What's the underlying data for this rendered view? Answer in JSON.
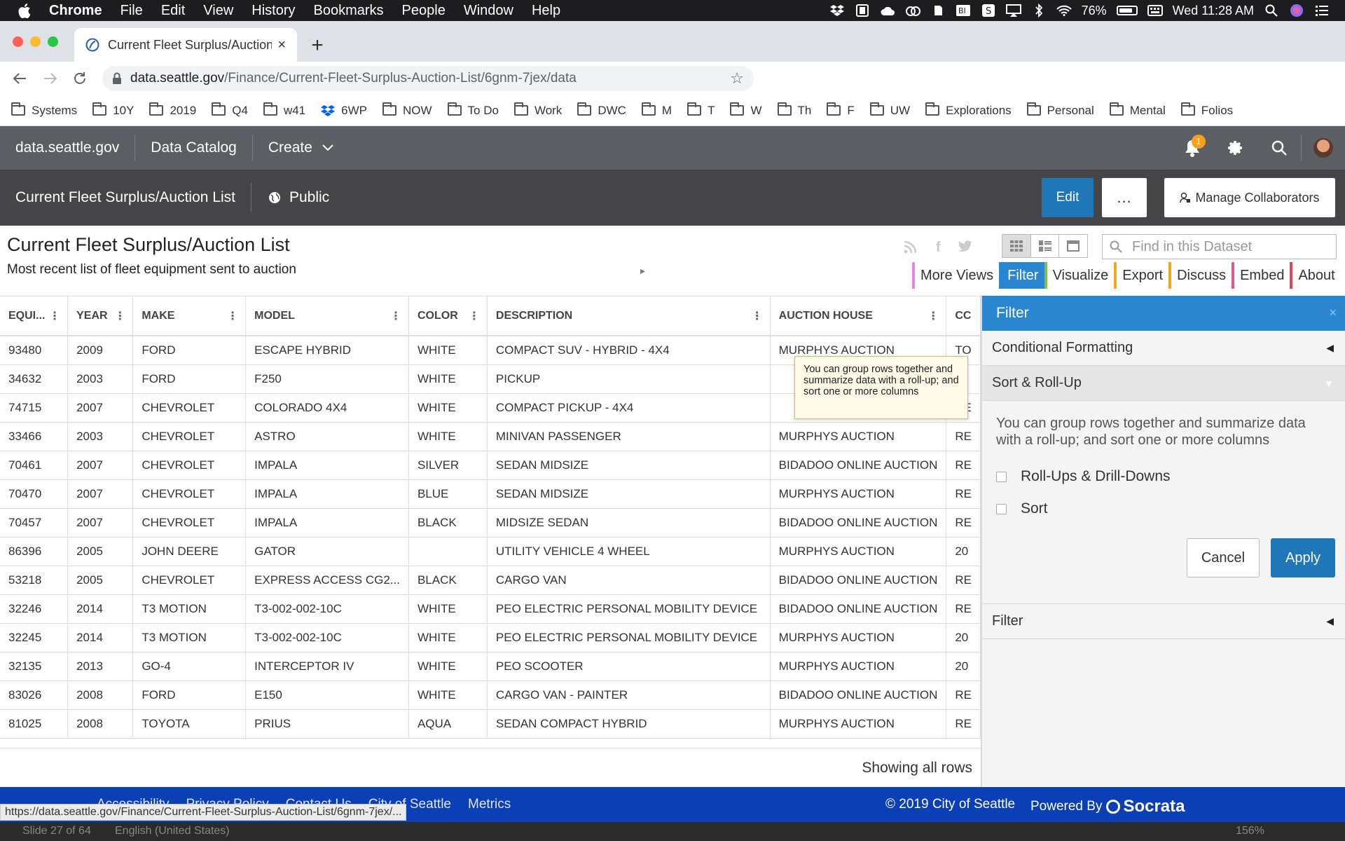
{
  "menubar": {
    "app": "Chrome",
    "items": [
      "File",
      "Edit",
      "View",
      "History",
      "Bookmarks",
      "People",
      "Window",
      "Help"
    ],
    "battery": "76%",
    "clock": "Wed 11:28 AM"
  },
  "browser": {
    "tab_title": "Current Fleet Surplus/Auction L",
    "url_host": "data.seattle.gov",
    "url_path": "/Finance/Current-Fleet-Surplus-Auction-List/6gnm-7jex/data",
    "status_url": "https://data.seattle.gov/Finance/Current-Fleet-Surplus-Auction-List/6gnm-7jex/..."
  },
  "bookmarks": [
    "Systems",
    "10Y",
    "2019",
    "Q4",
    "w41",
    "6WP",
    "NOW",
    "To Do",
    "Work",
    "DWC",
    "M",
    "T",
    "W",
    "Th",
    "F",
    "UW",
    "Explorations",
    "Personal",
    "Mental",
    "Folios"
  ],
  "sitenav": {
    "brand": "data.seattle.gov",
    "catalog": "Data Catalog",
    "create": "Create",
    "notification_count": "1"
  },
  "datasetbar": {
    "title": "Current Fleet Surplus/Auction List",
    "visibility": "Public",
    "edit": "Edit",
    "more": "...",
    "collaborators": "Manage Collaborators"
  },
  "dataset": {
    "title": "Current Fleet Surplus/Auction List",
    "subtitle": "Most recent list of fleet equipment sent to auction",
    "search_placeholder": "Find in this Dataset",
    "tabs": [
      {
        "label": "More Views",
        "color": "#e08ad8"
      },
      {
        "label": "Filter",
        "color": "#2a87cf"
      },
      {
        "label": "Visualize",
        "color": "#7fc241"
      },
      {
        "label": "Export",
        "color": "#f5a623"
      },
      {
        "label": "Discuss",
        "color": "#f5a623"
      },
      {
        "label": "Embed",
        "color": "#e05a87"
      },
      {
        "label": "About",
        "color": "#e0444f"
      }
    ]
  },
  "grid": {
    "columns": [
      "EQUI...",
      "YEAR",
      "MAKE",
      "MODEL",
      "COLOR",
      "DESCRIPTION",
      "AUCTION HOUSE",
      "CC"
    ],
    "rows": [
      [
        "93480",
        "2009",
        "FORD",
        "ESCAPE HYBRID",
        "WHITE",
        "COMPACT SUV - HYBRID - 4X4",
        "MURPHYS AUCTION",
        "TO"
      ],
      [
        "34632",
        "2003",
        "FORD",
        "F250",
        "WHITE",
        "PICKUP",
        "",
        ""
      ],
      [
        "74715",
        "2007",
        "CHEVROLET",
        "COLORADO 4X4",
        "WHITE",
        "COMPACT PICKUP - 4X4",
        "",
        "RE"
      ],
      [
        "33466",
        "2003",
        "CHEVROLET",
        "ASTRO",
        "WHITE",
        "MINIVAN PASSENGER",
        "MURPHYS AUCTION",
        "RE"
      ],
      [
        "70461",
        "2007",
        "CHEVROLET",
        "IMPALA",
        "SILVER",
        "SEDAN MIDSIZE",
        "BIDADOO ONLINE AUCTION",
        "RE"
      ],
      [
        "70470",
        "2007",
        "CHEVROLET",
        "IMPALA",
        "BLUE",
        "SEDAN MIDSIZE",
        "MURPHYS AUCTION",
        "RE"
      ],
      [
        "70457",
        "2007",
        "CHEVROLET",
        "IMPALA",
        "BLACK",
        "MIDSIZE SEDAN",
        "BIDADOO ONLINE AUCTION",
        "RE"
      ],
      [
        "86396",
        "2005",
        "JOHN DEERE",
        "GATOR",
        "",
        "UTILITY VEHICLE 4 WHEEL",
        "MURPHYS AUCTION",
        "20"
      ],
      [
        "53218",
        "2005",
        "CHEVROLET",
        "EXPRESS ACCESS CG2...",
        "BLACK",
        "CARGO VAN",
        "BIDADOO ONLINE AUCTION",
        "RE"
      ],
      [
        "32246",
        "2014",
        "T3 MOTION",
        "T3-002-002-10C",
        "WHITE",
        "PEO ELECTRIC PERSONAL MOBILITY DEVICE",
        "BIDADOO ONLINE AUCTION",
        "RE"
      ],
      [
        "32245",
        "2014",
        "T3 MOTION",
        "T3-002-002-10C",
        "WHITE",
        "PEO ELECTRIC PERSONAL MOBILITY DEVICE",
        "MURPHYS AUCTION",
        "20"
      ],
      [
        "32135",
        "2013",
        "GO-4",
        "INTERCEPTOR IV",
        "WHITE",
        "PEO SCOOTER",
        "MURPHYS AUCTION",
        "20"
      ],
      [
        "83026",
        "2008",
        "FORD",
        "E150",
        "WHITE",
        "CARGO VAN - PAINTER",
        "BIDADOO ONLINE AUCTION",
        "RE"
      ],
      [
        "81025",
        "2008",
        "TOYOTA",
        "PRIUS",
        "AQUA",
        "SEDAN COMPACT HYBRID",
        "MURPHYS AUCTION",
        "RE"
      ]
    ],
    "footer": "Showing all rows"
  },
  "tooltip": "You can group rows together and summarize data with a roll-up; and sort one or more columns",
  "panel": {
    "header": "Filter",
    "close": "×",
    "sections": {
      "conditional": "Conditional Formatting",
      "sort_rollup": "Sort & Roll-Up",
      "filter": "Filter"
    },
    "description": "You can group rows together and summarize data with a roll-up; and sort one or more columns",
    "options": [
      "Roll-Ups & Drill-Downs",
      "Sort"
    ],
    "cancel": "Cancel",
    "apply": "Apply"
  },
  "footer": {
    "links": [
      "Accessibility",
      "Privacy Policy",
      "Contact Us",
      "City of Seattle",
      "Metrics"
    ],
    "copyright": "© 2019 City of Seattle",
    "powered_by": "Powered By",
    "brand": "Socrata"
  },
  "bottomstrip": {
    "slide": "Slide 27 of 64",
    "language": "English (United States)",
    "zoom": "156%"
  }
}
